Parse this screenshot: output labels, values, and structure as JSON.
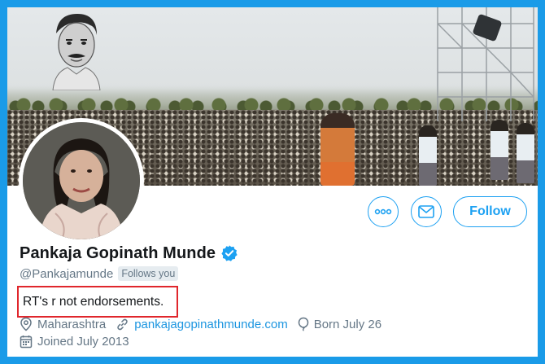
{
  "profile": {
    "name": "Pankaja Gopinath Munde",
    "handle": "@Pankajamunde",
    "follows_you": "Follows you",
    "bio": "RT's r not endorsements.",
    "location": "Maharashtra",
    "website": "pankajagopinathmunde.com",
    "birthday": "Born July 26",
    "joined": "Joined July 2013",
    "verified": true
  },
  "actions": {
    "follow_label": "Follow"
  },
  "icons": {
    "more": "more-icon",
    "message": "envelope-icon",
    "verified": "verified-badge-icon",
    "location": "location-pin-icon",
    "link": "link-icon",
    "birthday": "balloon-icon",
    "joined": "calendar-icon"
  },
  "colors": {
    "accent": "#1da1f2",
    "frame": "#1a9be8",
    "highlight_box": "#e0262c",
    "secondary_text": "#657786"
  }
}
